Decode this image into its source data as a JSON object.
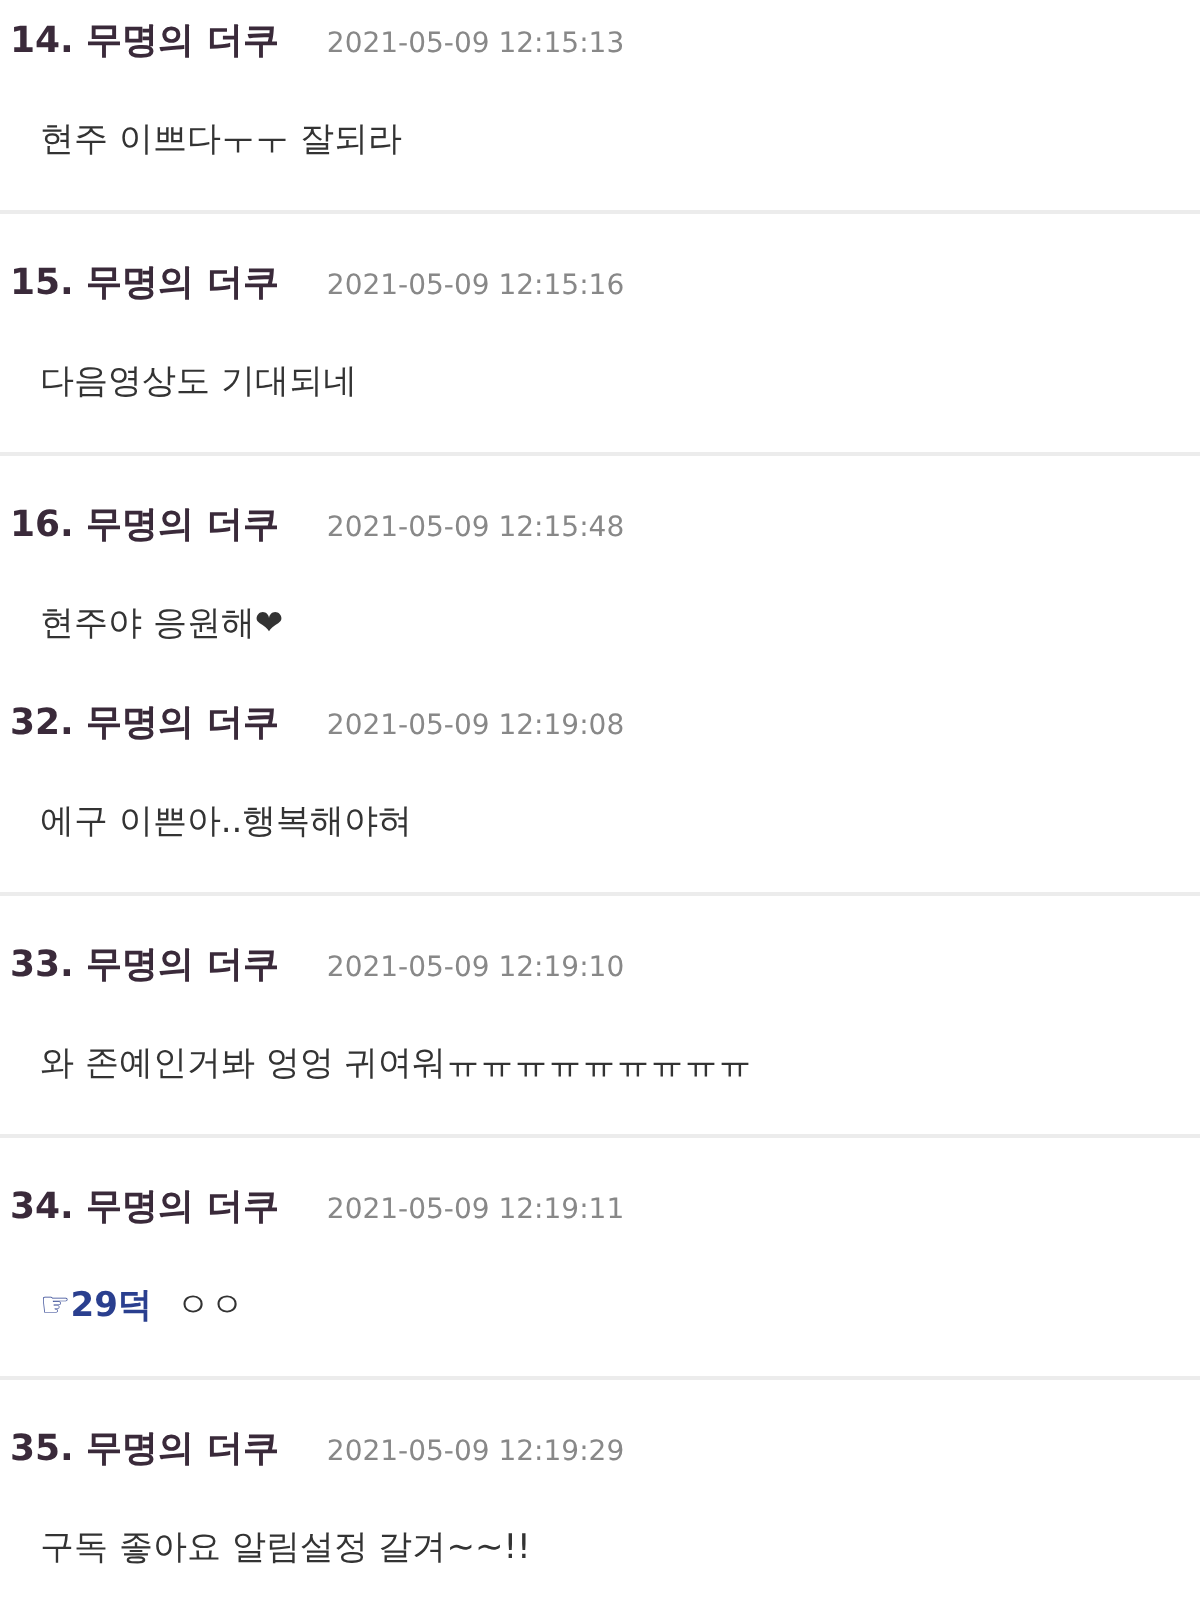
{
  "comments": [
    {
      "number": "14.",
      "author": "무명의 더쿠",
      "time": "2021-05-09 12:15:13",
      "text": "현주 이쁘다ㅜㅜ 잘되라",
      "divider": true
    },
    {
      "number": "15.",
      "author": "무명의 더쿠",
      "time": "2021-05-09 12:15:16",
      "text": "다음영상도 기대되네",
      "divider": true
    },
    {
      "number": "16.",
      "author": "무명의 더쿠",
      "time": "2021-05-09 12:15:48",
      "text": "현주야 응원해❤",
      "divider": false
    },
    {
      "number": "32.",
      "author": "무명의 더쿠",
      "time": "2021-05-09 12:19:08",
      "text": "에구 이쁜아..행복해야혀",
      "divider": true
    },
    {
      "number": "33.",
      "author": "무명의 더쿠",
      "time": "2021-05-09 12:19:10",
      "text": "와 존예인거봐 엉엉 귀여워ㅠㅠㅠㅠㅠㅠㅠㅠㅠ",
      "divider": true
    },
    {
      "number": "34.",
      "author": "무명의 더쿠",
      "time": "2021-05-09 12:19:11",
      "tag": "☞29덕",
      "text": "ㅇㅇ",
      "divider": true
    },
    {
      "number": "35.",
      "author": "무명의 더쿠",
      "time": "2021-05-09 12:19:29",
      "text": "구독 좋아요 알림설정 갈겨~~!!",
      "divider": false
    }
  ]
}
